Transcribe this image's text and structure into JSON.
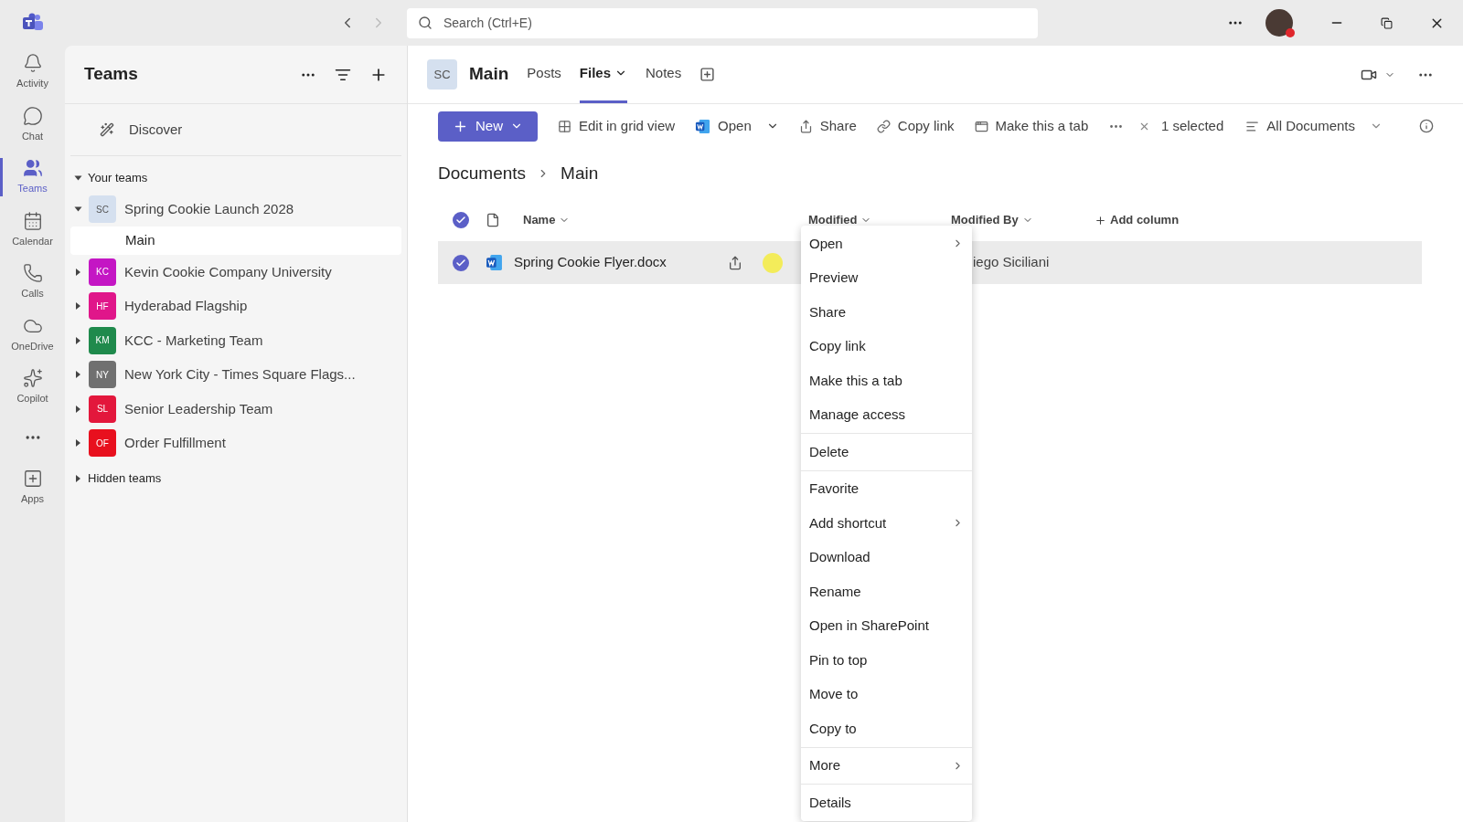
{
  "search": {
    "placeholder": "Search (Ctrl+E)"
  },
  "rail": [
    {
      "label": "Activity",
      "selected": false
    },
    {
      "label": "Chat",
      "selected": false
    },
    {
      "label": "Teams",
      "selected": true
    },
    {
      "label": "Calendar",
      "selected": false
    },
    {
      "label": "Calls",
      "selected": false
    },
    {
      "label": "OneDrive",
      "selected": false
    },
    {
      "label": "Copilot",
      "selected": false
    },
    {
      "label": "Apps",
      "selected": false
    }
  ],
  "sidebar": {
    "title": "Teams",
    "discover": "Discover",
    "section": "Your teams",
    "expanded": true,
    "teams": [
      {
        "initials": "SC",
        "name": "Spring Cookie Launch 2028",
        "color": "#d5e0ef",
        "expanded": true,
        "channels": [
          {
            "name": "Main",
            "selected": true
          }
        ]
      },
      {
        "initials": "KC",
        "name": "Kevin Cookie Company University",
        "color": "#c416c4",
        "expanded": false
      },
      {
        "initials": "HF",
        "name": "Hyderabad Flagship",
        "color": "#e0168a",
        "expanded": false
      },
      {
        "initials": "KM",
        "name": "KCC - Marketing Team",
        "color": "#1f8a4c",
        "expanded": false
      },
      {
        "initials": "NY",
        "name": "New York City - Times Square Flags...",
        "color": "#707070",
        "expanded": false
      },
      {
        "initials": "SL",
        "name": "Senior Leadership Team",
        "color": "#e3173c",
        "expanded": false
      },
      {
        "initials": "OF",
        "name": "Order Fulfillment",
        "color": "#e8101e",
        "expanded": false
      }
    ],
    "hidden": "Hidden teams"
  },
  "channel": {
    "initials": "SC",
    "title": "Main",
    "tabs": [
      {
        "label": "Posts",
        "selected": false,
        "dropdown": false
      },
      {
        "label": "Files",
        "selected": true,
        "dropdown": true
      },
      {
        "label": "Notes",
        "selected": false,
        "dropdown": false
      }
    ]
  },
  "toolbar": {
    "new": "New",
    "actions": [
      "Edit in grid view",
      "Open",
      "Share",
      "Copy link",
      "Make this a tab"
    ],
    "selected": "1 selected",
    "view": "All Documents"
  },
  "breadcrumb": [
    "Documents",
    "Main"
  ],
  "table": {
    "all_checked": true,
    "columns": [
      "Name",
      "Modified",
      "Modified By"
    ],
    "add_column": "Add column",
    "rows": [
      {
        "checked": true,
        "name": "Spring Cookie Flyer.docx",
        "modified_by": "iego Siciliani"
      }
    ]
  },
  "menu": [
    [
      {
        "label": "Open",
        "submenu": true
      },
      {
        "label": "Preview",
        "submenu": false
      },
      {
        "label": "Share",
        "submenu": false
      },
      {
        "label": "Copy link",
        "submenu": false
      },
      {
        "label": "Make this a tab",
        "submenu": false
      },
      {
        "label": "Manage access",
        "submenu": false
      }
    ],
    [
      {
        "label": "Delete",
        "submenu": false
      }
    ],
    [
      {
        "label": "Favorite",
        "submenu": false
      },
      {
        "label": "Add shortcut",
        "submenu": true
      },
      {
        "label": "Download",
        "submenu": false
      },
      {
        "label": "Rename",
        "submenu": false
      },
      {
        "label": "Open in SharePoint",
        "submenu": false
      },
      {
        "label": "Pin to top",
        "submenu": false
      },
      {
        "label": "Move to",
        "submenu": false
      },
      {
        "label": "Copy to",
        "submenu": false
      }
    ],
    [
      {
        "label": "More",
        "submenu": true
      }
    ],
    [
      {
        "label": "Details",
        "submenu": false
      }
    ]
  ]
}
